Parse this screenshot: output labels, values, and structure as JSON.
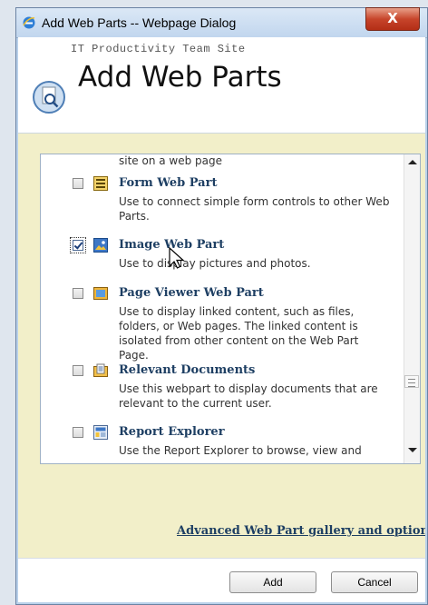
{
  "window": {
    "title": "Add Web Parts -- Webpage Dialog",
    "close_label": "X"
  },
  "header": {
    "site_name": "IT Productivity Team Site",
    "page_title": "Add Web Parts"
  },
  "list": {
    "partial_top_desc": "site on a web page",
    "items": [
      {
        "name": "Form Web Part",
        "desc": "Use to connect simple form controls to other Web Parts.",
        "checked": false,
        "icon": "form-icon"
      },
      {
        "name": "Image Web Part",
        "desc": "Use to display pictures and photos.",
        "checked": true,
        "icon": "image-icon"
      },
      {
        "name": "Page Viewer Web Part",
        "desc": "Use to display linked content, such as files, folders, or Web pages. The linked content is isolated from other content on the Web Part Page.",
        "checked": false,
        "icon": "page-viewer-icon"
      },
      {
        "name": "Relevant Documents",
        "desc": "Use this webpart to display documents that are relevant to the current user.",
        "checked": false,
        "icon": "documents-icon"
      },
      {
        "name": "Report Explorer",
        "desc": "Use the Report Explorer to browse, view and",
        "checked": false,
        "icon": "report-icon"
      }
    ]
  },
  "advanced_link": "Advanced Web Part gallery and options",
  "footer": {
    "add_label": "Add",
    "cancel_label": "Cancel"
  },
  "colors": {
    "title_bar": "#c1d6ee",
    "body_background": "#f2efc9",
    "link_color": "#1e3f63",
    "close_button": "#c7452b"
  }
}
